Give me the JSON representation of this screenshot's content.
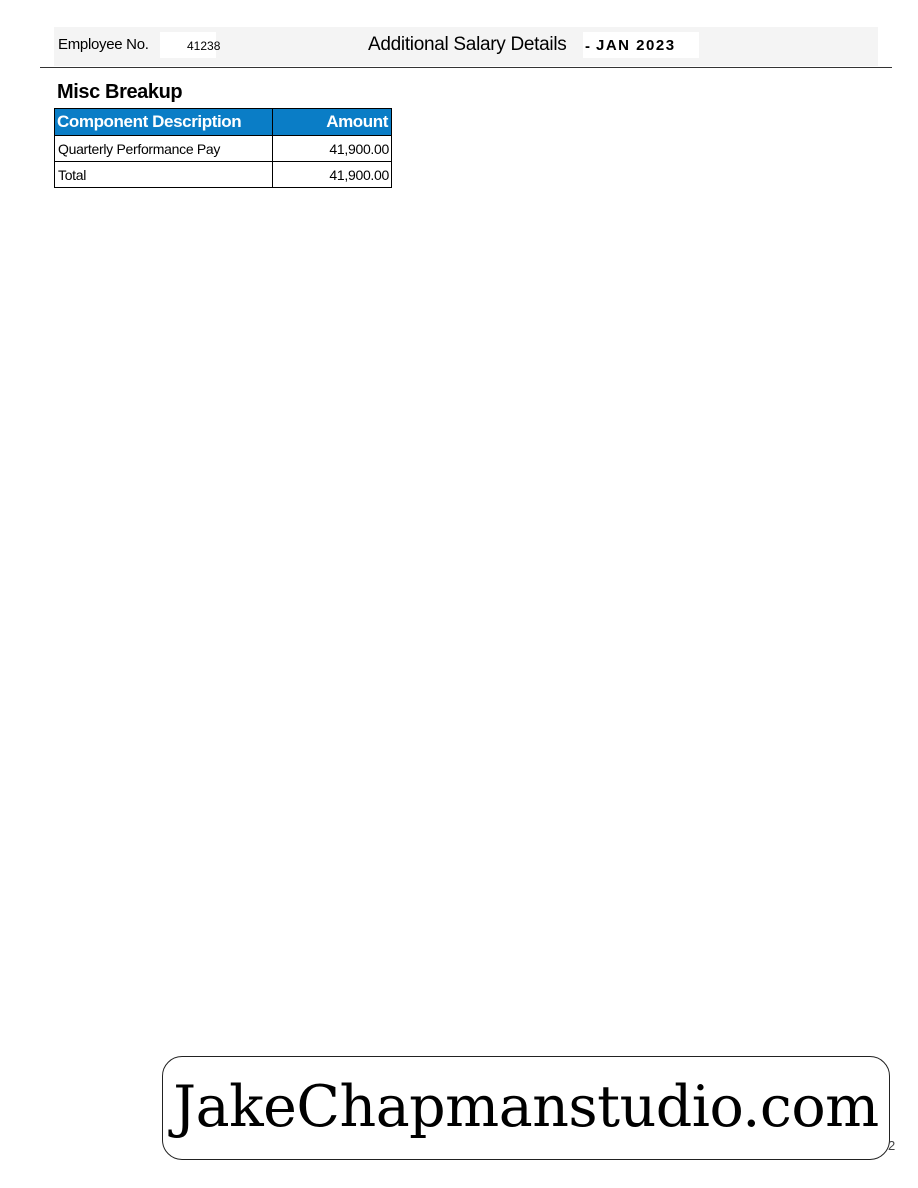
{
  "header": {
    "employee_label": "Employee No.",
    "employee_no": "41238",
    "title": "Additional Salary Details",
    "dash": "-",
    "period": "JAN 2023"
  },
  "section": {
    "title": "Misc Breakup"
  },
  "table": {
    "columns": [
      "Component Description",
      "Amount"
    ],
    "rows": [
      {
        "description": "Quarterly Performance Pay",
        "amount": "41,900.00"
      },
      {
        "description": "Total",
        "amount": "41,900.00"
      }
    ]
  },
  "watermark": {
    "text": "JakeChapmanstudio.com"
  },
  "footer": {
    "page": "2"
  },
  "colors": {
    "table_header_bg": "#0a7dc6",
    "header_bar_bg": "#f4f4f4"
  }
}
